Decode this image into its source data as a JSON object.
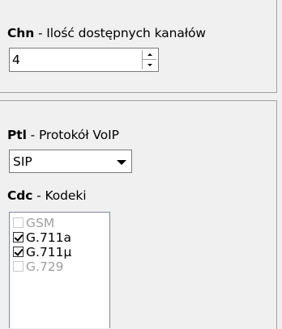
{
  "chn": {
    "code": "Chn",
    "description": " - Ilość dostępnych kanałów",
    "value": "4"
  },
  "ptl": {
    "code": "Ptl",
    "description": " - Protokół VoIP",
    "selected": "SIP"
  },
  "cdc": {
    "code": "Cdc",
    "description": " - Kodeki",
    "items": [
      {
        "label": "GSM",
        "checked": false,
        "enabled": false
      },
      {
        "label": "G.711a",
        "checked": true,
        "enabled": true
      },
      {
        "label": "G.711µ",
        "checked": true,
        "enabled": true
      },
      {
        "label": "G.729",
        "checked": false,
        "enabled": false
      }
    ]
  }
}
